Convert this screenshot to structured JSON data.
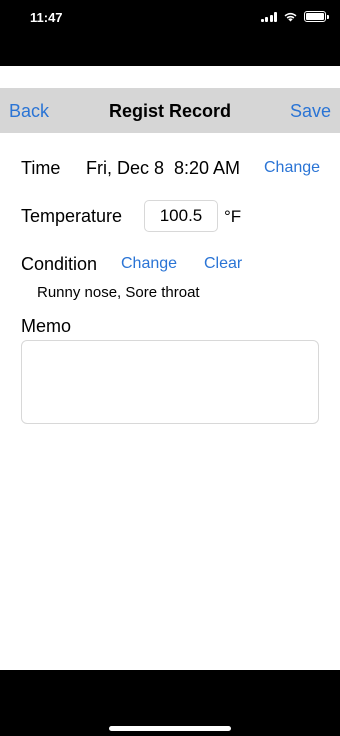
{
  "status_bar": {
    "time": "11:47",
    "icons": [
      "signal-icon",
      "wifi-icon",
      "battery-icon"
    ]
  },
  "navbar": {
    "back_label": "Back",
    "title": "Regist Record",
    "save_label": "Save"
  },
  "time_row": {
    "label": "Time",
    "value": "Fri, Dec 8  8:20 AM",
    "change_label": "Change"
  },
  "temperature_row": {
    "label": "Temperature",
    "value": "100.5",
    "unit": "°F"
  },
  "condition_row": {
    "label": "Condition",
    "change_label": "Change",
    "clear_label": "Clear",
    "selected": "Runny nose, Sore throat"
  },
  "memo": {
    "label": "Memo",
    "value": ""
  },
  "colors": {
    "accent": "#2a74d5",
    "navbar_bg": "#d6d6d6"
  }
}
